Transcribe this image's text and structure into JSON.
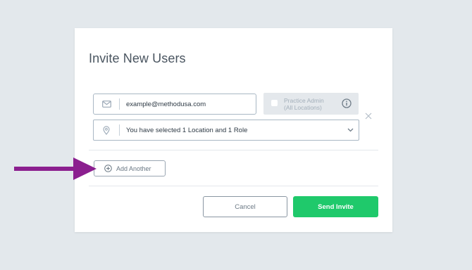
{
  "modal": {
    "title": "Invite New Users",
    "email_value": "example@methodusa.com",
    "practice_admin_line1": "Practice Admin",
    "practice_admin_line2": "(All Locations)",
    "practice_admin_checked": false,
    "location_summary": "You have selected 1 Location and 1 Role",
    "add_another_label": "Add Another",
    "cancel_label": "Cancel",
    "send_label": "Send Invite"
  },
  "icons": {
    "email": "envelope-icon",
    "location": "map-pin-icon",
    "info": "info-icon",
    "remove": "close-icon",
    "dropdown": "chevron-down-icon",
    "add": "plus-circle-icon",
    "annotation": "arrow-right-icon"
  },
  "colors": {
    "background": "#e3e8ec",
    "primary_button": "#1fc96b",
    "annotation_arrow": "#8b1f8f",
    "field_border": "#a9b7c4",
    "title_text": "#4a5560"
  }
}
